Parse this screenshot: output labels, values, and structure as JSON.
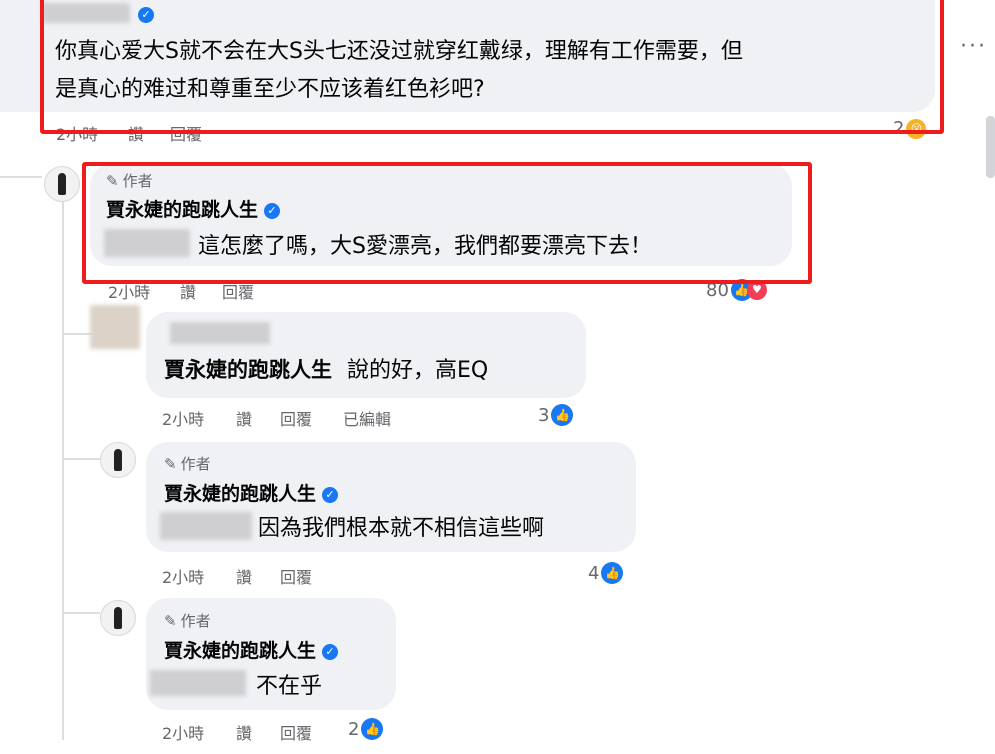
{
  "comment1": {
    "text_line1": "你真心爱大S就不会在大S头七还没过就穿红戴绿，理解有工作需要，但",
    "text_line2": "是真心的难过和尊重至少不应该着红色衫吧?",
    "time": "2小時",
    "like_action": "讚",
    "reply_action": "回覆",
    "reaction_count": "2"
  },
  "reply1": {
    "author_tag": "作者",
    "name": "賈永婕的跑跳人生",
    "text": "這怎麼了嗎，大S愛漂亮，我們都要漂亮下去！",
    "time": "2小時",
    "like_action": "讚",
    "reply_action": "回覆",
    "reaction_count": "80"
  },
  "reply2": {
    "mention": "賈永婕的跑跳人生",
    "text": "說的好，高EQ",
    "time": "2小時",
    "like_action": "讚",
    "reply_action": "回覆",
    "edited": "已編輯",
    "reaction_count": "3"
  },
  "reply3": {
    "author_tag": "作者",
    "name": "賈永婕的跑跳人生",
    "text": "因為我們根本就不相信這些啊",
    "time": "2小時",
    "like_action": "讚",
    "reply_action": "回覆",
    "reaction_count": "4"
  },
  "reply4": {
    "author_tag": "作者",
    "name": "賈永婕的跑跳人生",
    "text": "不在乎",
    "time": "2小時",
    "like_action": "讚",
    "reply_action": "回覆",
    "reaction_count": "2"
  },
  "icons": {
    "like": "👍",
    "heart": "♥",
    "verified": "✓",
    "pen": "✎",
    "more": "···"
  },
  "colors": {
    "highlight_box": "#ee1c1c",
    "bubble": "#eff1f4",
    "like_blue": "#1877f2"
  }
}
